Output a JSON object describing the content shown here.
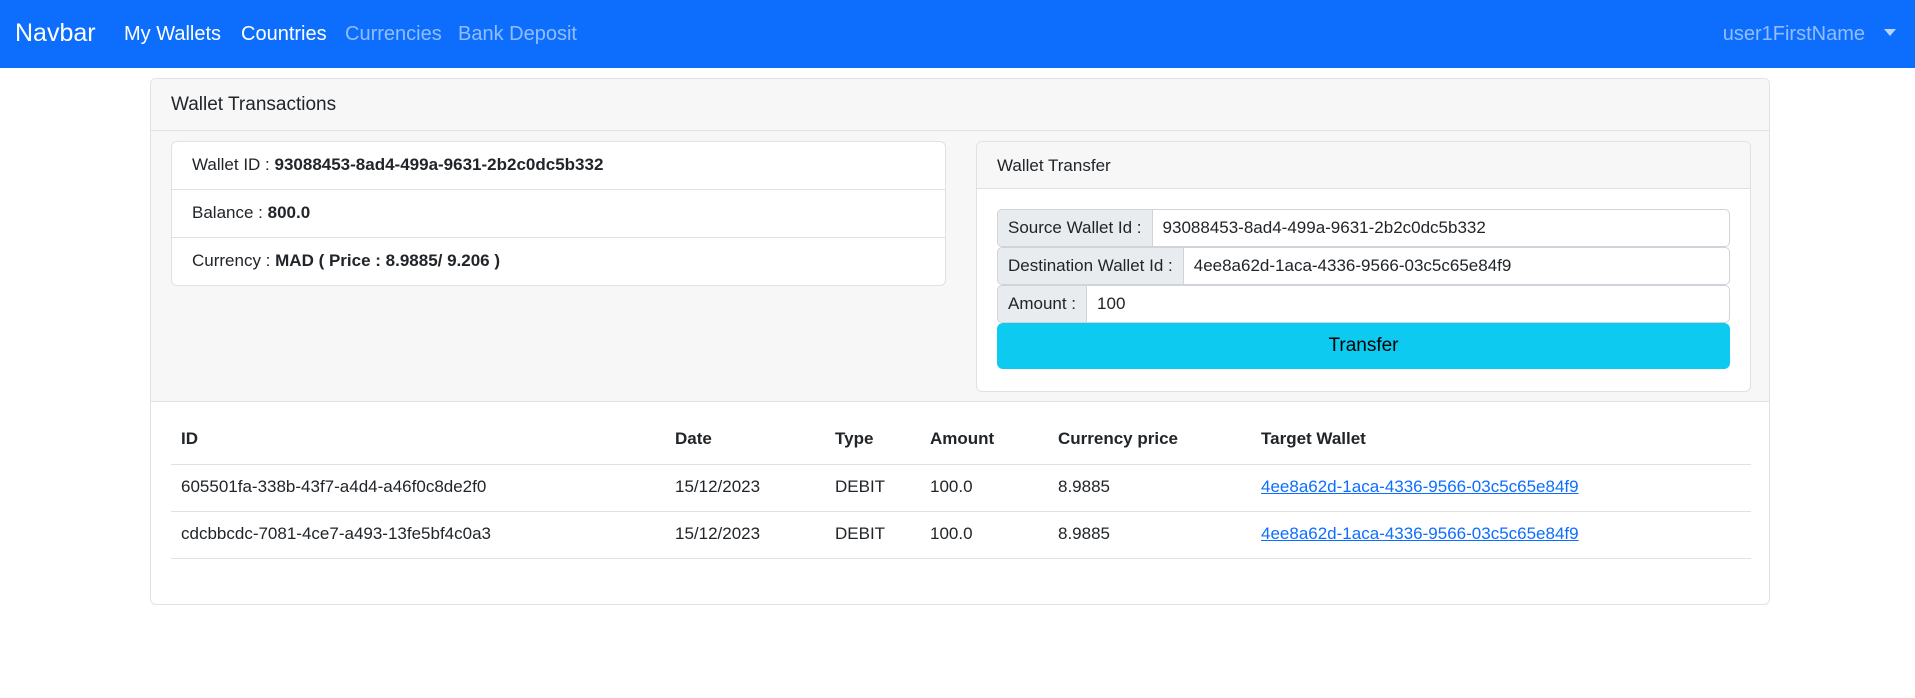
{
  "navbar": {
    "brand": "Navbar",
    "links": [
      "My Wallets",
      "Countries",
      "Currencies",
      "Bank Deposit"
    ],
    "user": "user1FirstName"
  },
  "card": {
    "title": "Wallet Transactions",
    "wallet": {
      "id_label": "Wallet ID : ",
      "id_value": "93088453-8ad4-499a-9631-2b2c0dc5b332",
      "balance_label": "Balance : ",
      "balance_value": "800.0",
      "currency_label": "Currency : ",
      "currency_value": "MAD ( Price : 8.9885/ 9.206 )"
    },
    "transfer": {
      "title": "Wallet Transfer",
      "source_label": "Source Wallet Id :",
      "source_value": "93088453-8ad4-499a-9631-2b2c0dc5b332",
      "destination_label": "Destination Wallet Id :",
      "destination_value": "4ee8a62d-1aca-4336-9566-03c5c65e84f9",
      "amount_label": "Amount :",
      "amount_value": "100",
      "button_label": "Transfer"
    }
  },
  "table": {
    "headers": [
      "ID",
      "Date",
      "Type",
      "Amount",
      "Currency price",
      "Target Wallet"
    ],
    "rows": [
      [
        "605501fa-338b-43f7-a4d4-a46f0c8de2f0",
        "15/12/2023",
        "DEBIT",
        "100.0",
        "8.9885",
        "4ee8a62d-1aca-4336-9566-03c5c65e84f9"
      ],
      [
        "cdcbbcdc-7081-4ce7-a493-13fe5bf4c0a3",
        "15/12/2023",
        "DEBIT",
        "100.0",
        "8.9885",
        "4ee8a62d-1aca-4336-9566-03c5c65e84f9"
      ]
    ]
  },
  "colors": {
    "navbar": "#0d6efd",
    "transfer_button": "#0dcaf0",
    "link": "#0d6efd"
  }
}
